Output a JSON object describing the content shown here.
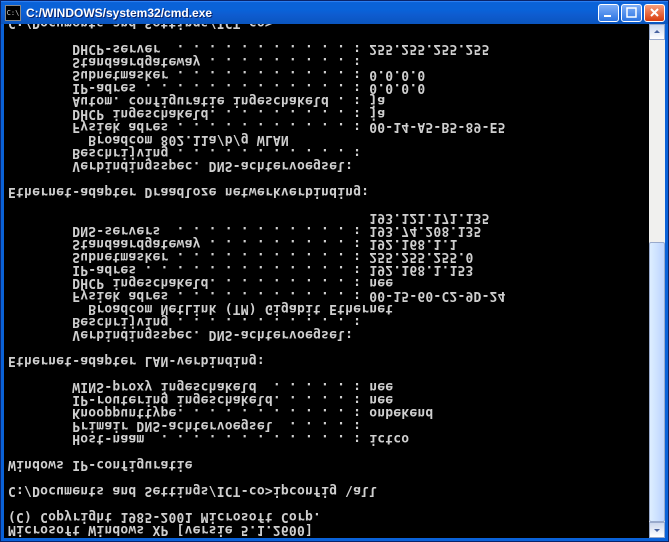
{
  "titlebar": {
    "icon_label": "C:\\",
    "title": "C:/WINDOWS/system32/cmd.exe"
  },
  "terminal": {
    "lines": [
      "Microsoft Windows XP [versie 5.1.2600]",
      "(C) Copyright 1985-2001 Microsoft Corp.",
      "",
      "C:/Documents and Settings/ICT-co>ipconfig \\all",
      "",
      "Windows IP-configuratie",
      "",
      "        Host-naam  . . . . . . . . . . . . : ictco",
      "        Primair DNS-achtervoegsel  . . . . :",
      "        Knooppunttype. . . . . . . . . . . : onbekend",
      "        IP-routering ingeschakeld. . . . . : nee",
      "        WINS-proxy ingeschakeld  . . . . . : nee",
      "",
      "Ethernet-adapter LAN-verbinding:",
      "",
      "        Verbindingsspec. DNS-achtervoegsel:",
      "        Beschrijving . . . . . . . . . . . :",
      "          Broadcom NetLink (TM) Gigabit Ethernet",
      "        Fysiek adres . . . . . . . . . . . : 00-15-60-C2-9D-24",
      "        DHCP ingeschakeld. . . . . . . . . : nee",
      "        IP-adres . . . . . . . . . . . . . : 192.168.1.153",
      "        Subnetmasker . . . . . . . . . . . : 255.255.255.0",
      "        Standaardgateway . . . . . . . . . : 192.168.1.1",
      "        DNS-servers  . . . . . . . . . . . : 193.74.208.135",
      "                                             193.121.171.135",
      "",
      "Ethernet-adapter Draadloze netwerkverbinding:",
      "",
      "        Verbindingsspec. DNS-achtervoegsel:",
      "        Beschrijving . . . . . . . . . . . :",
      "          Broadcom 802.11a/b/g WLAN",
      "        Fysiek adres . . . . . . . . . . . : 00-14-A5-B5-89-E5",
      "        DHCP ingeschakeld. . . . . . . . . : ja",
      "        Autom. configuratie ingeschakeld . : ja",
      "        IP-adres . . . . . . . . . . . . . : 0.0.0.0",
      "        Subnetmasker . . . . . . . . . . . : 0.0.0.0",
      "        Standaardgateway . . . . . . . . . :",
      "        DHCP-server  . . . . . . . . . . . : 255.255.255.255",
      "",
      "C:/Documents and Settings/ICT-co>"
    ]
  }
}
